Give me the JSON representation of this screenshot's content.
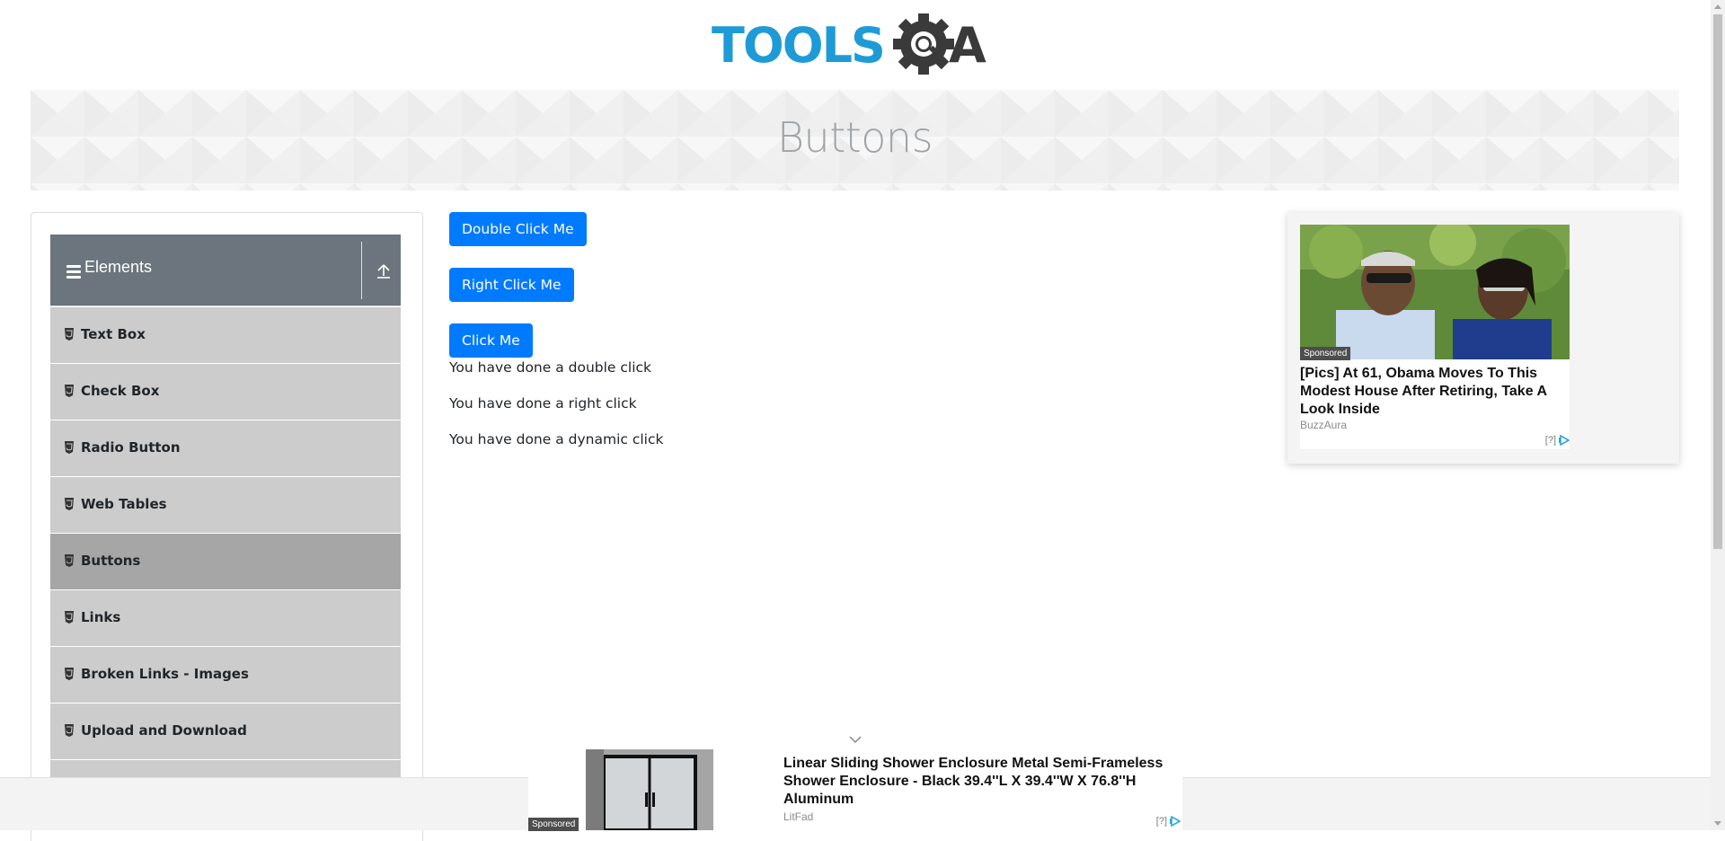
{
  "header": {
    "logo_text_left": "TOOLS",
    "logo_text_right": "A"
  },
  "banner": {
    "title": "Buttons"
  },
  "sidebar": {
    "group_title": "Elements",
    "items": [
      {
        "label": "Text Box",
        "active": false
      },
      {
        "label": "Check Box",
        "active": false
      },
      {
        "label": "Radio Button",
        "active": false
      },
      {
        "label": "Web Tables",
        "active": false
      },
      {
        "label": "Buttons",
        "active": true
      },
      {
        "label": "Links",
        "active": false
      },
      {
        "label": "Broken Links - Images",
        "active": false
      },
      {
        "label": "Upload and Download",
        "active": false
      }
    ]
  },
  "main": {
    "double_click_label": "Double Click Me",
    "right_click_label": "Right Click Me",
    "click_label": "Click Me",
    "messages": [
      "You have done a double click",
      "You have done a right click",
      "You have done a dynamic click"
    ]
  },
  "ad_right": {
    "sponsored": "Sponsored",
    "headline": "[Pics] At 61, Obama Moves To This Modest House After Retiring, Take A Look Inside",
    "source": "BuzzAura",
    "adchoices": "[?]"
  },
  "ad_bottom": {
    "sponsored": "Sponsored",
    "headline": "Linear Sliding Shower Enclosure Metal Semi-Frameless Shower Enclosure - Black 39.4''L X 39.4''W X 76.8''H Aluminum",
    "source": "LitFad",
    "adchoices": "[?]"
  },
  "colors": {
    "primary_button": "#007bff",
    "sidebar_header": "#6c757d",
    "menu_item": "#cccccc",
    "menu_item_active": "#a6a6a6",
    "logo_blue": "#1e9bd7",
    "logo_dark": "#3a3a3a"
  },
  "icons": {
    "menu": "hamburger-icon",
    "collapse": "collapse-up-icon",
    "item": "html5-shield-icon",
    "bottom_ad_toggle": "chevron-down-icon",
    "adchoices": "adchoices-icon"
  }
}
